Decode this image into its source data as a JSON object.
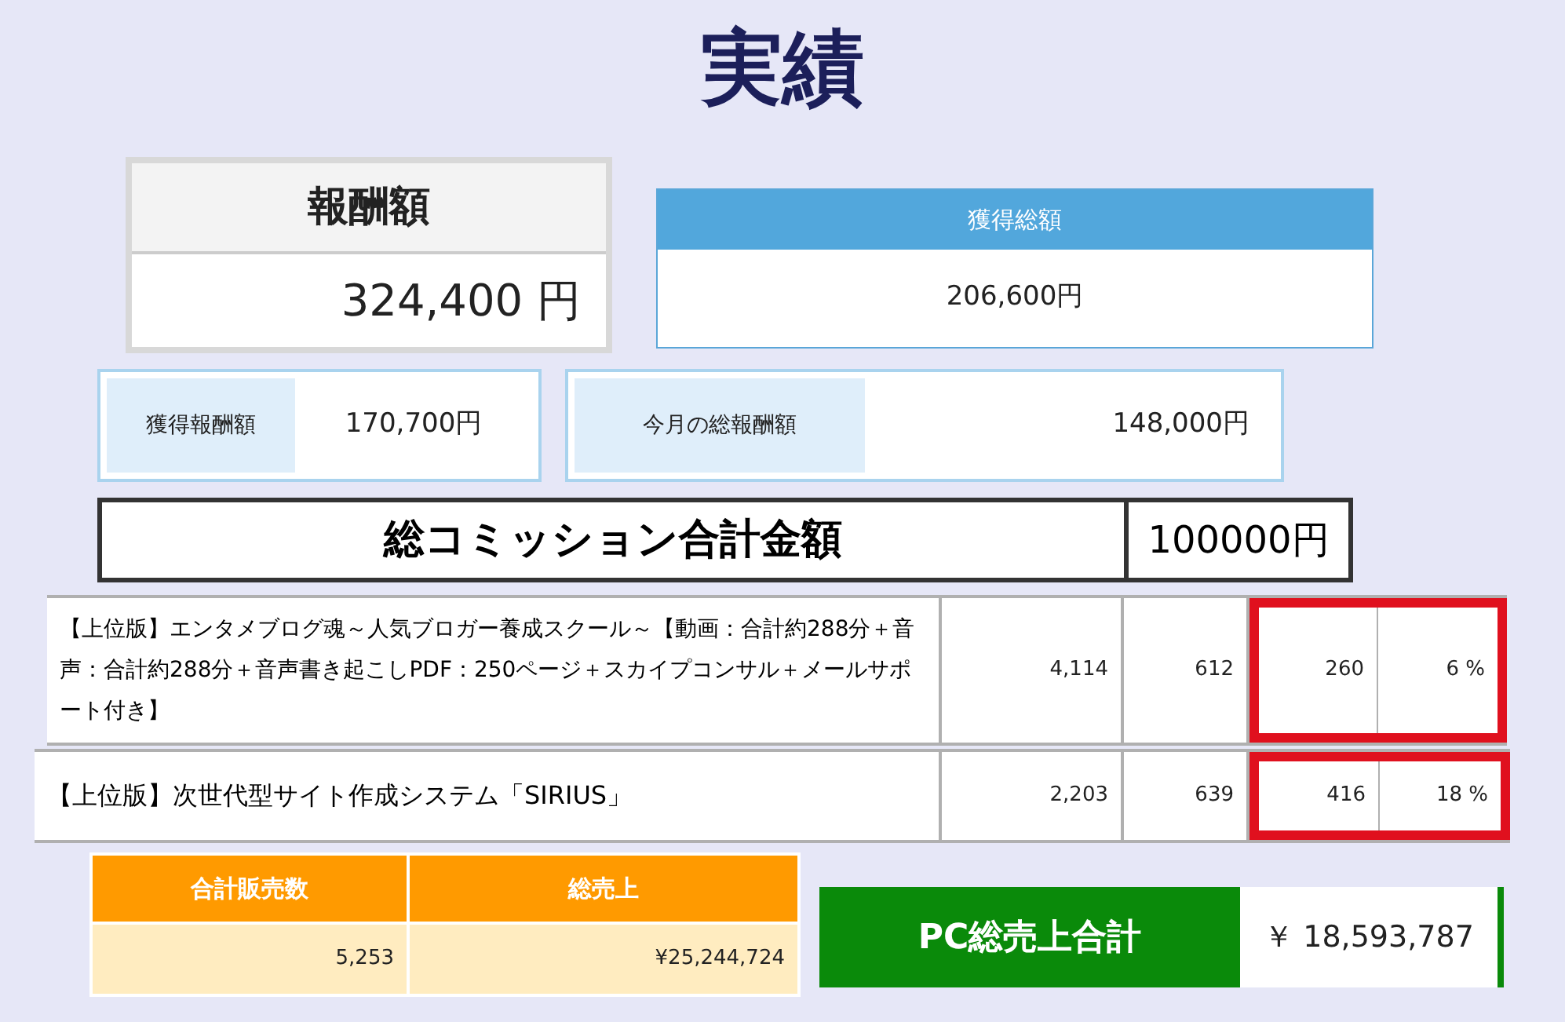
{
  "title": "実績",
  "reward_total": {
    "label": "報酬額",
    "value": "324,400 円"
  },
  "acquired_total": {
    "label": "獲得総額",
    "value": "206,600円"
  },
  "acquired_reward": {
    "label": "獲得報酬額",
    "value": "170,700円"
  },
  "monthly_reward": {
    "label": "今月の総報酬額",
    "value": "148,000円"
  },
  "commission": {
    "label": "総コミッション合計金額",
    "value": "100000円"
  },
  "products": [
    {
      "name": "【上位版】エンタメブログ魂～人気ブロガー養成スクール～【動画：合計約288分＋音声：合計約288分＋音声書き起こしPDF：250ページ＋スカイプコンサル＋メールサポート付き】",
      "column_2": "4,114",
      "column_3": "612",
      "column_4": "260",
      "column_5": "6 %",
      "highlighted": true
    },
    {
      "name": "【上位版】次世代型サイト作成システム「SIRIUS」",
      "column_2": "2,203",
      "column_3": "639",
      "column_4": "416",
      "column_5": "18 %",
      "highlighted": true
    }
  ],
  "sales_summary": {
    "columns": [
      "合計販売数",
      "総売上"
    ],
    "values": [
      "5,253",
      "¥25,244,724"
    ]
  },
  "pc_sales": {
    "label": "PC総売上合計",
    "value": "￥ 18,593,787"
  }
}
